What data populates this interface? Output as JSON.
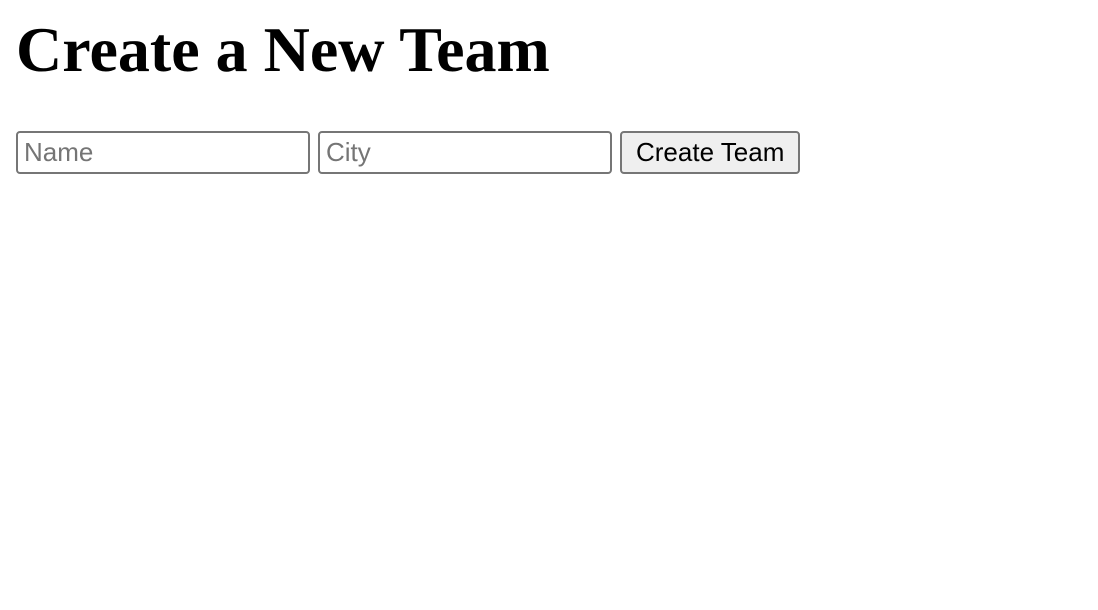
{
  "page": {
    "title": "Create a New Team"
  },
  "form": {
    "name_field": {
      "placeholder": "Name",
      "value": ""
    },
    "city_field": {
      "placeholder": "City",
      "value": ""
    },
    "submit_label": "Create Team"
  }
}
